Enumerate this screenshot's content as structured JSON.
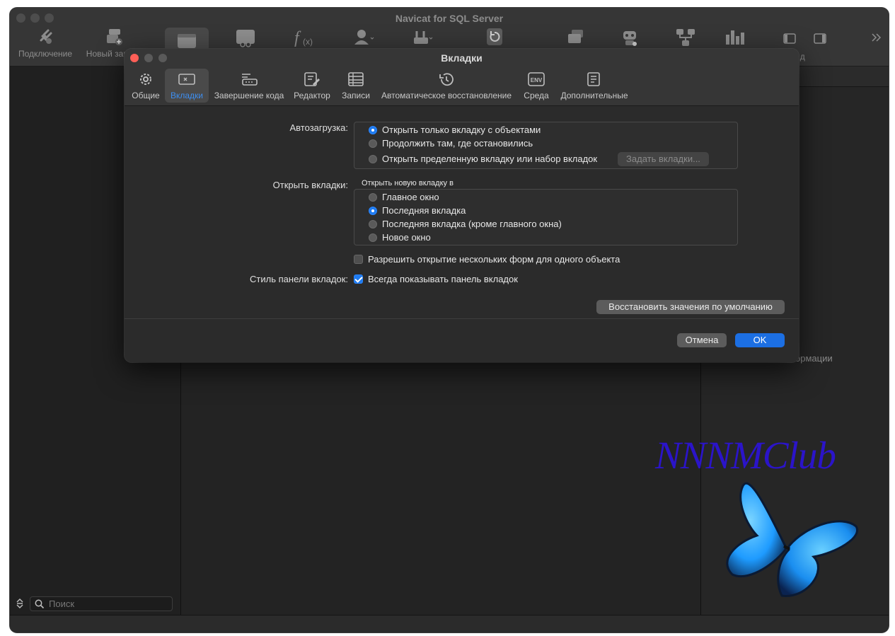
{
  "app": {
    "title": "Navicat for SQL Server",
    "toolbar": [
      {
        "label": "Подключение",
        "icon": "plug-icon"
      },
      {
        "label": "Новый запрос",
        "icon": "new-query-icon"
      },
      {
        "label": "",
        "icon": "table-icon"
      },
      {
        "label": "",
        "icon": "view-icon"
      },
      {
        "label": "",
        "icon": "function-icon"
      },
      {
        "label": "",
        "icon": "user-icon"
      },
      {
        "label": "",
        "icon": "tools-icon"
      },
      {
        "label": "",
        "icon": "backup-icon"
      },
      {
        "label": "",
        "icon": "automation-icon"
      },
      {
        "label": "",
        "icon": "robot-icon"
      },
      {
        "label": "",
        "icon": "model-icon"
      },
      {
        "label": "",
        "icon": "chart-icon"
      },
      {
        "label": "",
        "icon": "sidebar-left-icon"
      },
      {
        "label": "Вид",
        "icon": "sidebar-right-icon"
      },
      {
        "label": "",
        "icon": "chevron-double-right-icon"
      }
    ],
    "search_placeholder": "Поиск",
    "right_panel_peek": "ормации"
  },
  "dialog": {
    "title": "Вкладки",
    "tabs": [
      {
        "label": "Общие",
        "icon": "gear-icon",
        "active": false
      },
      {
        "label": "Вкладки",
        "icon": "tabs-icon",
        "active": true
      },
      {
        "label": "Завершение кода",
        "icon": "keyboard-icon",
        "active": false
      },
      {
        "label": "Редактор",
        "icon": "editor-icon",
        "active": false
      },
      {
        "label": "Записи",
        "icon": "records-icon",
        "active": false
      },
      {
        "label": "Автоматическое восстановление",
        "icon": "history-icon",
        "active": false
      },
      {
        "label": "Среда",
        "icon": "env-icon",
        "active": false
      },
      {
        "label": "Дополнительные",
        "icon": "advanced-icon",
        "active": false
      }
    ],
    "autoload": {
      "label": "Автозагрузка:",
      "options": [
        {
          "text": "Открыть только вкладку с объектами",
          "selected": true
        },
        {
          "text": "Продолжить там, где остановились",
          "selected": false
        },
        {
          "text": "Открыть пределенную вкладку или набор вкладок",
          "selected": false
        }
      ],
      "set_tabs_button": "Задать вкладки..."
    },
    "open_tabs": {
      "label": "Открыть вкладки:",
      "group_caption": "Открыть новую вкладку в",
      "options": [
        {
          "text": "Главное окно",
          "selected": false
        },
        {
          "text": "Последняя вкладка",
          "selected": true
        },
        {
          "text": "Последняя вкладка (кроме главного окна)",
          "selected": false
        },
        {
          "text": "Новое окно",
          "selected": false
        }
      ]
    },
    "multi_form": {
      "text": "Разрешить открытие нескольких форм для одного объекта",
      "checked": false
    },
    "tab_bar_style": {
      "label": "Стиль панели вкладок:",
      "text": "Всегда показывать панель вкладок",
      "checked": true
    },
    "restore_defaults": "Восстановить значения по умолчанию",
    "cancel": "Отмена",
    "ok": "OK"
  },
  "watermark": {
    "text": "NNNMClub"
  },
  "colors": {
    "accent": "#1f7bf0",
    "close_red": "#ff5f57",
    "window_bg": "#262626",
    "dialog_bg": "#2b2b2b",
    "watermark_text": "#2b14c9",
    "butterfly_blue": "#1e9bff"
  }
}
